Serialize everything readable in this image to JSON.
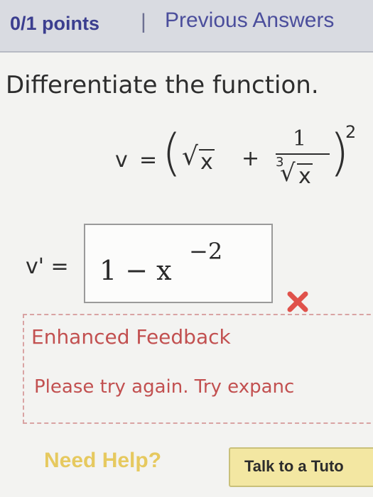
{
  "header": {
    "points": "0/1 points",
    "separator": "|",
    "previous_answers": "Previous Answers"
  },
  "question": {
    "prompt": "Differentiate the function."
  },
  "formula": {
    "lhs": "v",
    "equals": "=",
    "left_paren": "(",
    "sqrt_symbol": "√",
    "sqrt_arg": "x",
    "plus": "+",
    "numerator": "1",
    "root_index": "3",
    "root_symbol": "√",
    "root_arg": "x",
    "right_paren": ")",
    "exponent": "2"
  },
  "answer": {
    "label": "v' =",
    "value": "1 − x",
    "exponent": "−2",
    "status_icon": "wrong-x-icon",
    "status_color": "#e0524b"
  },
  "feedback": {
    "title": "Enhanced Feedback",
    "message": "Please try again. Try expanc"
  },
  "help": {
    "label": "Need Help?",
    "button_label": "Talk to a Tuto"
  }
}
